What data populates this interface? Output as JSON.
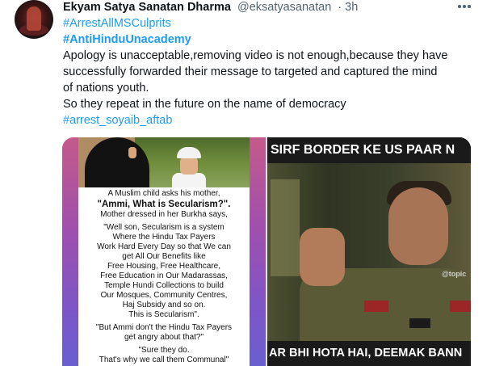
{
  "tweet": {
    "author_name": "Ekyam Satya Sanatan Dharma",
    "author_handle": "@eksatyasanatan",
    "time": "· 3h",
    "hashtags_top": [
      "#ArrestAllMSCulprits",
      "#AntiHinduUnacademy"
    ],
    "body_lines": [
      "Apology is unacceptable,removing video is not enough,because they have",
      "successfully forwarded their message to targeted and captured the mind",
      "of nations youth.",
      "So they repeat in the future on the name of democracy"
    ],
    "hashtag_bottom": "#arrest_soyaib_aftab",
    "icons": {
      "more": "more-dots-icon",
      "avatar": "avatar"
    },
    "colors": {
      "link": "#1d9bf0",
      "secondary_text": "#536471",
      "text": "#0f1419"
    }
  },
  "media": {
    "left_image_text": [
      "A Muslim child asks his mother,",
      "\"Ammi, What is Secularism?\".",
      "Mother dressed in her Burkha says,",
      "\"Well son, Secularism is a system",
      "Where the Hindu Tax Payers",
      "Work Hard Every Day so that We can",
      "get All Our Benefits like",
      "Free Housing, Free Healthcare,",
      "Free Education in Our Madarassas,",
      "Temple Hundi Collections to build",
      "Our Mosques, Community Centres,",
      "Haj Subsidy and so on.",
      "This is Secularism\".",
      "\"But Ammi don't the Hindu Tax Payers",
      "get angry about that?\"",
      "\"Sure they do.",
      "That's why we call them Communal\""
    ],
    "right_image_top_caption": "SIRF BORDER KE US PAAR N",
    "right_image_bottom_caption": "AR BHI HOTA HAI, DEEMAK BANN",
    "right_image_watermark": "@topic"
  }
}
